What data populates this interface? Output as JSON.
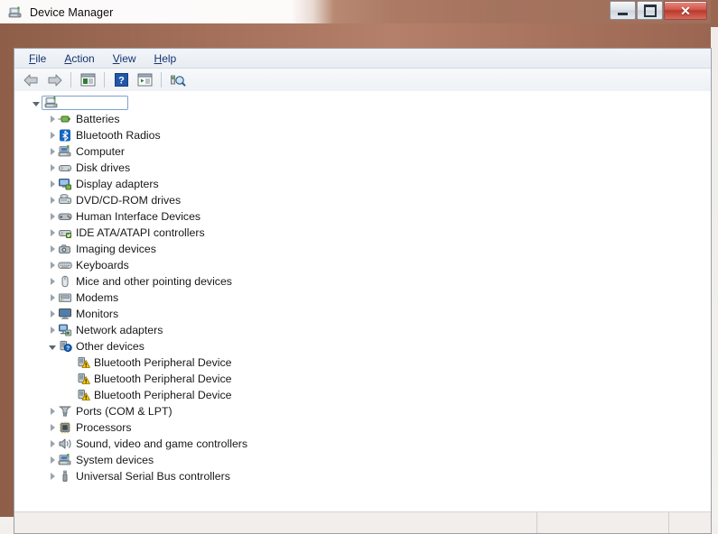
{
  "window": {
    "title": "Device Manager",
    "icon": "device-manager-icon",
    "controls": {
      "minimize": "Minimize",
      "maximize": "Maximize",
      "close": "Close",
      "close_glyph": "✕"
    }
  },
  "menubar": {
    "items": [
      {
        "label": "File",
        "accesskey": "F",
        "rest": "ile"
      },
      {
        "label": "Action",
        "accesskey": "A",
        "rest": "ction"
      },
      {
        "label": "View",
        "accesskey": "V",
        "rest": "iew"
      },
      {
        "label": "Help",
        "accesskey": "H",
        "rest": "elp"
      }
    ]
  },
  "toolbar": {
    "buttons": [
      {
        "name": "back-button",
        "icon": "back-arrow-icon",
        "tooltip": "Back"
      },
      {
        "name": "forward-button",
        "icon": "forward-arrow-icon",
        "tooltip": "Forward"
      },
      {
        "name": "show-hide-console-tree",
        "icon": "console-tree-icon",
        "tooltip": "Show/Hide Console Tree"
      },
      {
        "name": "help-button",
        "icon": "help-question-icon",
        "tooltip": "Help"
      },
      {
        "name": "properties-button",
        "icon": "properties-icon",
        "tooltip": "Properties"
      },
      {
        "name": "scan-hardware-button",
        "icon": "scan-hardware-icon",
        "tooltip": "Scan for hardware changes"
      }
    ]
  },
  "tree": {
    "root": {
      "label": "",
      "icon": "computer-icon",
      "expanded": true,
      "selected": true
    },
    "nodes": [
      {
        "label": "Batteries",
        "icon": "battery-icon",
        "expanded": false,
        "level": 1
      },
      {
        "label": "Bluetooth Radios",
        "icon": "bluetooth-icon",
        "expanded": false,
        "level": 1
      },
      {
        "label": "Computer",
        "icon": "computer-icon",
        "expanded": false,
        "level": 1
      },
      {
        "label": "Disk drives",
        "icon": "disk-drive-icon",
        "expanded": false,
        "level": 1
      },
      {
        "label": "Display adapters",
        "icon": "display-icon",
        "expanded": false,
        "level": 1
      },
      {
        "label": "DVD/CD-ROM drives",
        "icon": "dvd-drive-icon",
        "expanded": false,
        "level": 1
      },
      {
        "label": "Human Interface Devices",
        "icon": "hid-icon",
        "expanded": false,
        "level": 1
      },
      {
        "label": "IDE ATA/ATAPI controllers",
        "icon": "ide-controller-icon",
        "expanded": false,
        "level": 1
      },
      {
        "label": "Imaging devices",
        "icon": "camera-icon",
        "expanded": false,
        "level": 1
      },
      {
        "label": "Keyboards",
        "icon": "keyboard-icon",
        "expanded": false,
        "level": 1
      },
      {
        "label": "Mice and other pointing devices",
        "icon": "mouse-icon",
        "expanded": false,
        "level": 1
      },
      {
        "label": "Modems",
        "icon": "modem-icon",
        "expanded": false,
        "level": 1
      },
      {
        "label": "Monitors",
        "icon": "monitor-icon",
        "expanded": false,
        "level": 1
      },
      {
        "label": "Network adapters",
        "icon": "network-adapter-icon",
        "expanded": false,
        "level": 1
      },
      {
        "label": "Other devices",
        "icon": "unknown-device-icon",
        "expanded": true,
        "level": 1
      },
      {
        "label": "Bluetooth Peripheral Device",
        "icon": "warning-device-icon",
        "expanded": null,
        "level": 2
      },
      {
        "label": "Bluetooth Peripheral Device",
        "icon": "warning-device-icon",
        "expanded": null,
        "level": 2
      },
      {
        "label": "Bluetooth Peripheral Device",
        "icon": "warning-device-icon",
        "expanded": null,
        "level": 2
      },
      {
        "label": "Ports (COM & LPT)",
        "icon": "port-icon",
        "expanded": false,
        "level": 1
      },
      {
        "label": "Processors",
        "icon": "processor-icon",
        "expanded": false,
        "level": 1
      },
      {
        "label": "Sound, video and game controllers",
        "icon": "sound-icon",
        "expanded": false,
        "level": 1
      },
      {
        "label": "System devices",
        "icon": "system-device-icon",
        "expanded": false,
        "level": 1
      },
      {
        "label": "Universal Serial Bus controllers",
        "icon": "usb-icon",
        "expanded": false,
        "level": 1
      }
    ]
  },
  "statusbar": {
    "main": "",
    "pane_b": "",
    "pane_c": ""
  },
  "colors": {
    "accent_brown": "#a4705a",
    "menu_text": "#14326e",
    "warning_yellow": "#ffcc00",
    "close_red": "#c0392b",
    "selection_border": "#7da2ce"
  }
}
